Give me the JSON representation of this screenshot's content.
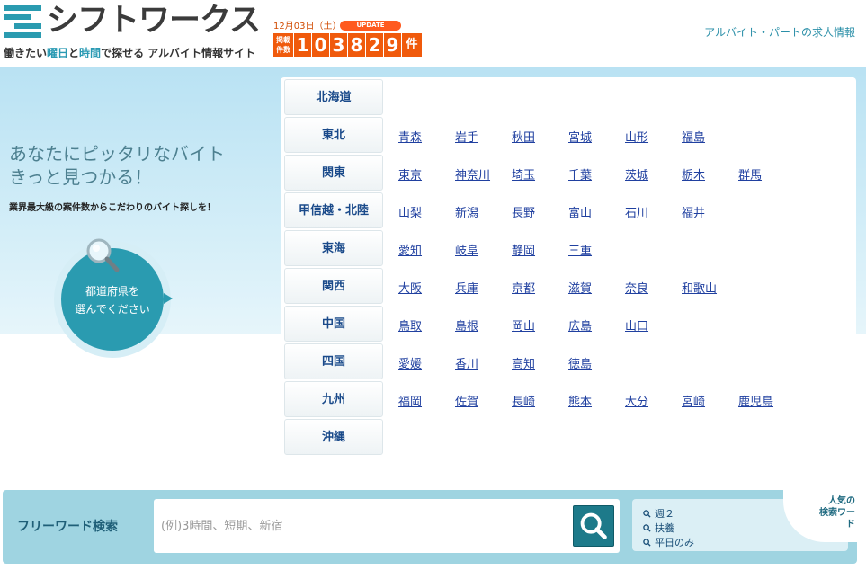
{
  "header": {
    "logo_text": "シフトワークス",
    "tagline_parts": [
      "働きたい",
      "曜日",
      "と",
      "時間",
      "で探せる アルバイト情報サイト"
    ],
    "date_label": "12月03日（土）",
    "update_badge": "UPDATE",
    "counter_label": "掲載件数",
    "counter_digits": [
      "1",
      "0",
      "3",
      "8",
      "2",
      "9"
    ],
    "counter_unit": "件",
    "right_link": "アルバイト・パートの求人情報"
  },
  "hero": {
    "title_line1": "あなたにピッタリなバイト",
    "title_line2": "きっと見つかる！",
    "subtitle": "業界最大級の案件数からこだわりのバイト探しを！",
    "circle_line1": "都道府県を",
    "circle_line2": "選んでください"
  },
  "regions": [
    {
      "label": "北海道",
      "prefectures": []
    },
    {
      "label": "東北",
      "prefectures": [
        "青森",
        "岩手",
        "秋田",
        "宮城",
        "山形",
        "福島"
      ]
    },
    {
      "label": "関東",
      "prefectures": [
        "東京",
        "神奈川",
        "埼玉",
        "千葉",
        "茨城",
        "栃木",
        "群馬"
      ]
    },
    {
      "label": "甲信越・北陸",
      "prefectures": [
        "山梨",
        "新潟",
        "長野",
        "富山",
        "石川",
        "福井"
      ]
    },
    {
      "label": "東海",
      "prefectures": [
        "愛知",
        "岐阜",
        "静岡",
        "三重"
      ]
    },
    {
      "label": "関西",
      "prefectures": [
        "大阪",
        "兵庫",
        "京都",
        "滋賀",
        "奈良",
        "和歌山"
      ]
    },
    {
      "label": "中国",
      "prefectures": [
        "鳥取",
        "島根",
        "岡山",
        "広島",
        "山口"
      ]
    },
    {
      "label": "四国",
      "prefectures": [
        "愛媛",
        "香川",
        "高知",
        "徳島"
      ]
    },
    {
      "label": "九州",
      "prefectures": [
        "福岡",
        "佐賀",
        "長崎",
        "熊本",
        "大分",
        "宮崎",
        "鹿児島"
      ]
    },
    {
      "label": "沖縄",
      "prefectures": []
    }
  ],
  "search": {
    "label": "フリーワード検索",
    "placeholder": "(例)3時間、短期、新宿",
    "popular_title_line1": "人気の",
    "popular_title_line2": "検索ワード",
    "popular_keywords": [
      "週２",
      "扶養",
      "平日のみ"
    ]
  },
  "colors": {
    "accent": "#2a9bb0",
    "counter": "#f05a0c",
    "link": "#2040a0"
  }
}
